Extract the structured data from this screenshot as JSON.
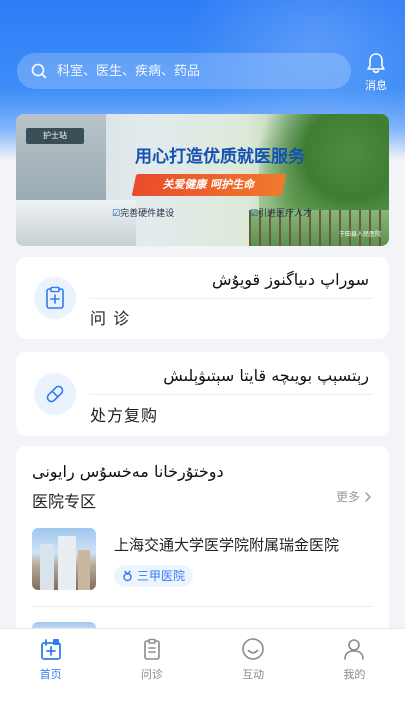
{
  "search": {
    "placeholder": "科室、医生、疾病、药品",
    "icon": "search-icon"
  },
  "messages": {
    "label": "消息",
    "icon": "bell-icon"
  },
  "banner": {
    "sign_text": "护士站",
    "title": "用心打造优质就医服务",
    "slogan": "关爱健康  呵护生命",
    "features": [
      "完善硬件建设",
      "引进医疗人才"
    ],
    "credit": "于田县人民医院"
  },
  "consult": {
    "ug_title": "سوراپ دىياگنوز قويۇش",
    "zh_title": "问  诊",
    "icon": "clipboard-plus-icon"
  },
  "prescription": {
    "ug_title": "رېتسېپ بويىچە قايتا سېتىۋېلىش",
    "zh_title": "处方复购",
    "icon": "pill-icon"
  },
  "hospital_section": {
    "ug_title": "دوختۇرخانا مەخسۇس رايونى",
    "title": "医院专区",
    "more": "更多",
    "items": [
      {
        "name": "上海交通大学医学院附属瑞金医院",
        "level": "三甲医院"
      }
    ]
  },
  "tabbar": {
    "items": [
      {
        "label": "首页",
        "icon": "home-medical-icon",
        "active": true
      },
      {
        "label": "问诊",
        "icon": "clipboard-icon",
        "active": false
      },
      {
        "label": "互动",
        "icon": "smile-icon",
        "active": false
      },
      {
        "label": "我的",
        "icon": "user-icon",
        "active": false
      }
    ]
  },
  "colors": {
    "primary": "#2f7df6",
    "text": "#222222",
    "muted": "#8a8a8a",
    "background": "#f2f4f7"
  }
}
